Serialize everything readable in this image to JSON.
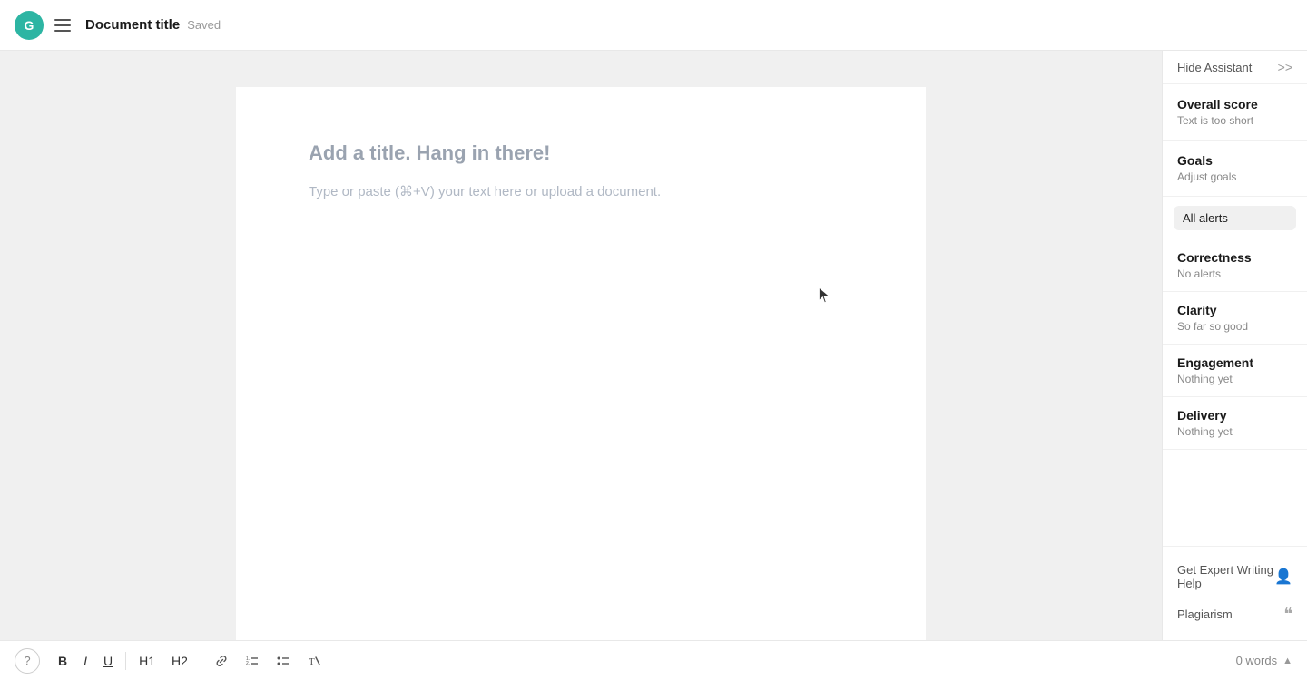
{
  "header": {
    "avatar_label": "G",
    "doc_title": "Document title",
    "saved_label": "Saved"
  },
  "sidebar": {
    "hide_assistant_label": "Hide Assistant",
    "chevron_label": ">>",
    "overall_score": {
      "title": "Overall score",
      "subtitle": "Text is too short"
    },
    "goals": {
      "title": "Goals",
      "subtitle": "Adjust goals"
    },
    "all_alerts_label": "All alerts",
    "categories": [
      {
        "title": "Correctness",
        "subtitle": "No alerts"
      },
      {
        "title": "Clarity",
        "subtitle": "So far so good"
      },
      {
        "title": "Engagement",
        "subtitle": "Nothing yet"
      },
      {
        "title": "Delivery",
        "subtitle": "Nothing yet"
      }
    ],
    "footer": {
      "expert_help_label": "Get Expert Writing Help",
      "plagiarism_label": "Plagiarism"
    }
  },
  "editor": {
    "placeholder_title": "Add a title. Hang in there!",
    "placeholder_body": "Type or paste (⌘+V) your text here or upload a document."
  },
  "toolbar": {
    "bold_label": "B",
    "italic_label": "I",
    "underline_label": "U",
    "h1_label": "H1",
    "h2_label": "H2",
    "word_count": "0 words",
    "help_label": "?"
  }
}
